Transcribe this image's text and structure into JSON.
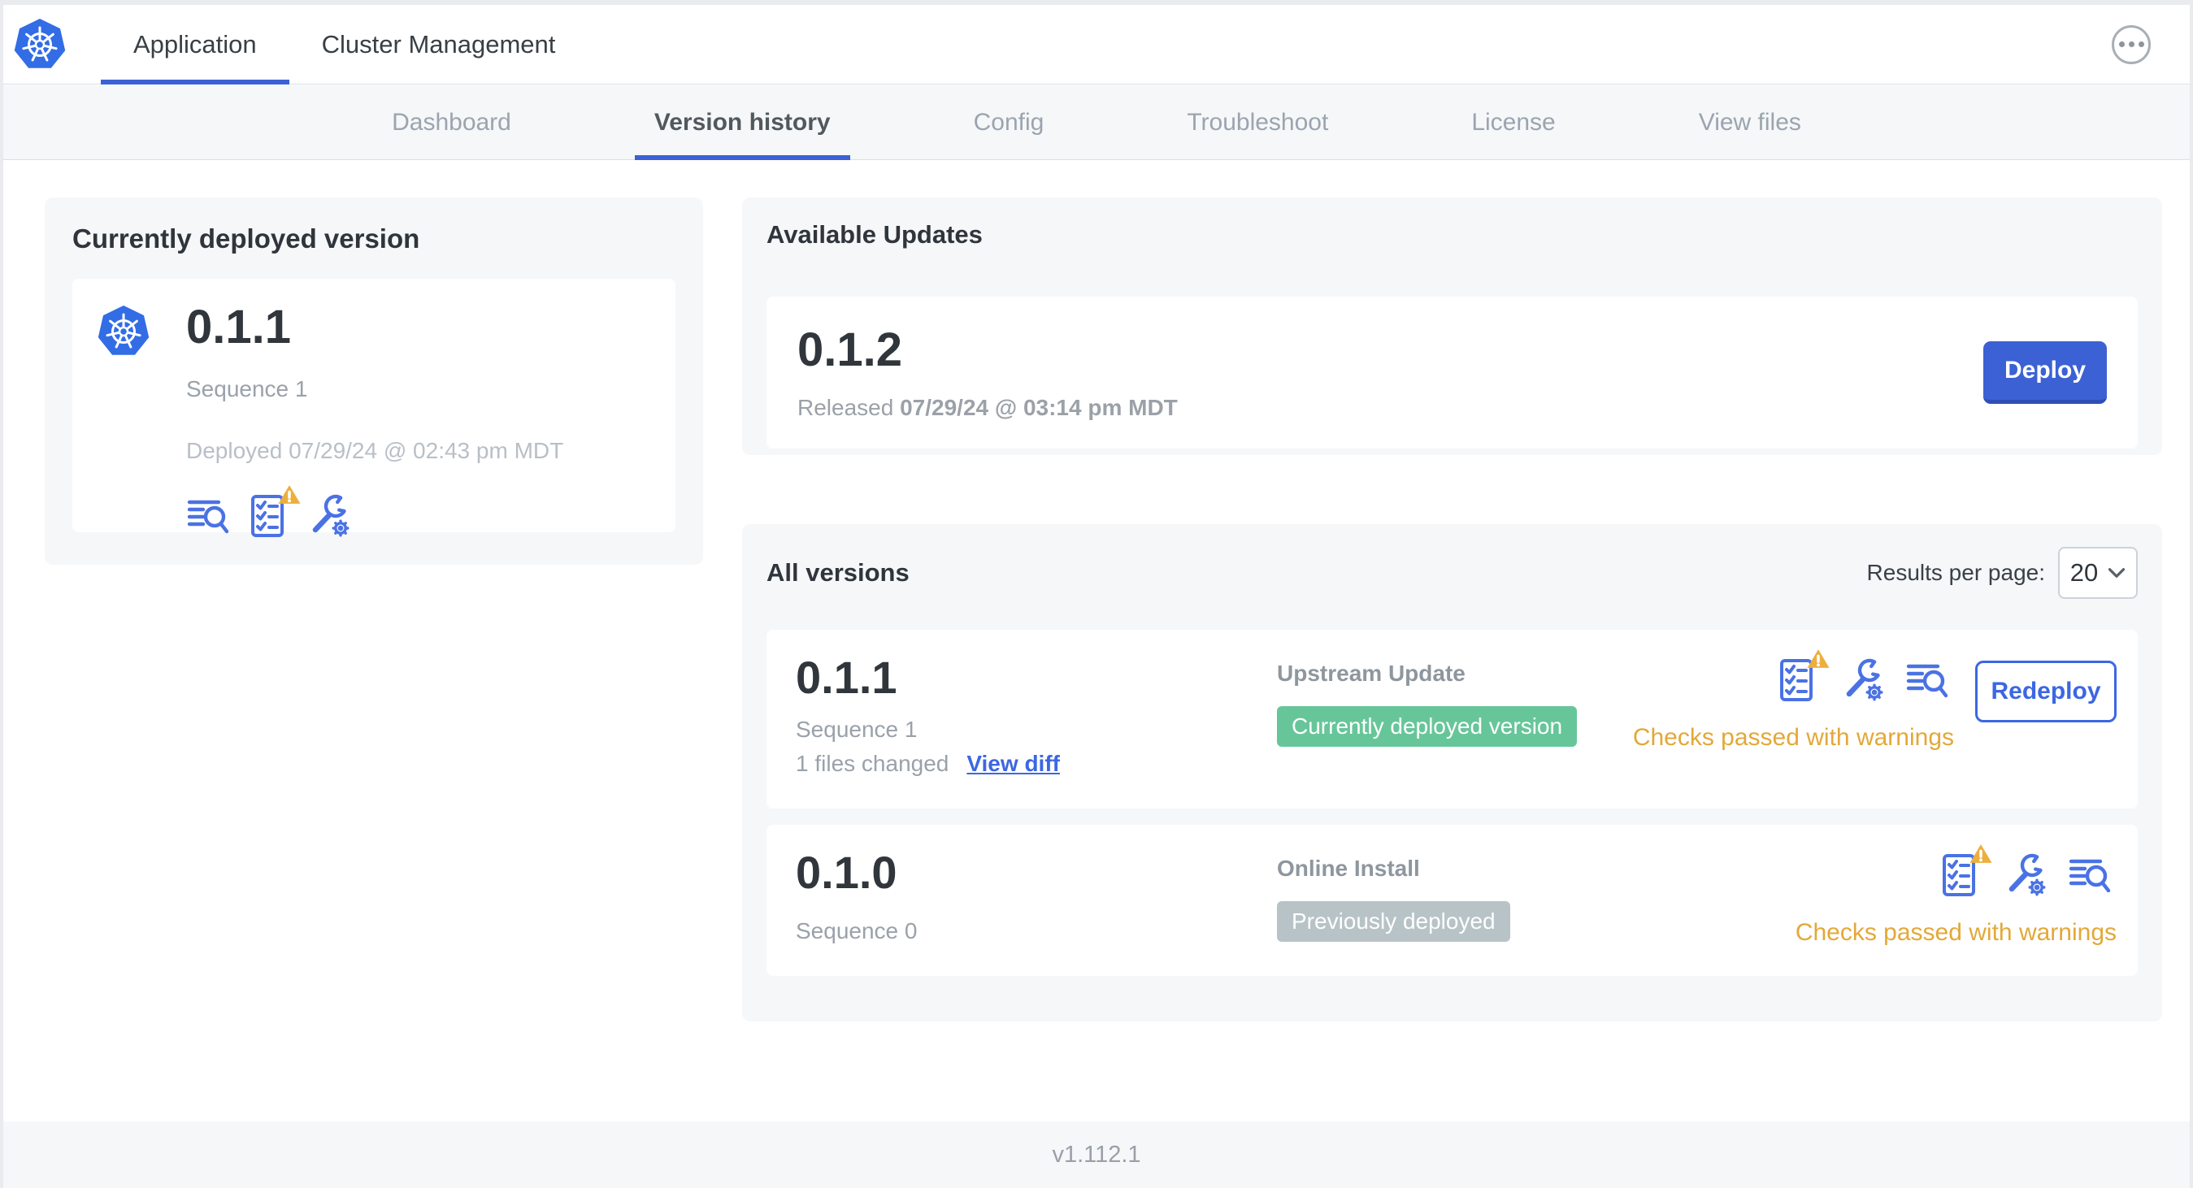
{
  "colors": {
    "accent_blue": "#3c61d4",
    "link_blue": "#3c67e3",
    "icon_blue": "#4a72e4",
    "kubernetes_blue": "#326de6",
    "warning_amber": "#e3a838",
    "success_green": "#67c699",
    "badge_gray": "#b8c3c7",
    "panel_gray": "#f5f7f9"
  },
  "icons": {
    "logo": "kubernetes-logo",
    "app_menu": "ellipsis-icon",
    "view_files": "view-files-icon",
    "preflight": "preflight-checks-icon",
    "edit_config": "edit-config-icon",
    "warning": "warning-triangle-icon",
    "dropdown": "chevron-down-icon"
  },
  "header": {
    "tabs": [
      {
        "label": "Application",
        "active": true
      },
      {
        "label": "Cluster Management",
        "active": false
      }
    ]
  },
  "subnav": {
    "tabs": [
      {
        "label": "Dashboard",
        "active": false
      },
      {
        "label": "Version history",
        "active": true
      },
      {
        "label": "Config",
        "active": false
      },
      {
        "label": "Troubleshoot",
        "active": false
      },
      {
        "label": "License",
        "active": false
      },
      {
        "label": "View files",
        "active": false
      }
    ]
  },
  "current_version": {
    "title": "Currently deployed version",
    "version": "0.1.1",
    "sequence": "Sequence 1",
    "deployed": "Deployed 07/29/24 @ 02:43 pm MDT"
  },
  "available_updates": {
    "title": "Available Updates",
    "version": "0.1.2",
    "released_prefix": "Released",
    "released_date": "07/29/24 @ 03:14 pm MDT",
    "deploy_label": "Deploy"
  },
  "all_versions": {
    "title": "All versions",
    "results_per_page_label": "Results per page:",
    "results_per_page_value": "20",
    "rows": [
      {
        "version": "0.1.1",
        "sequence": "Sequence 1",
        "files_changed": "1 files changed",
        "view_diff_label": "View diff",
        "source": "Upstream Update",
        "badge": "Currently deployed version",
        "status": "Checks passed with warnings",
        "action_label": "Redeploy"
      },
      {
        "version": "0.1.0",
        "sequence": "Sequence 0",
        "source": "Online Install",
        "badge": "Previously deployed",
        "status": "Checks passed with warnings"
      }
    ]
  },
  "footer": {
    "version": "v1.112.1"
  }
}
